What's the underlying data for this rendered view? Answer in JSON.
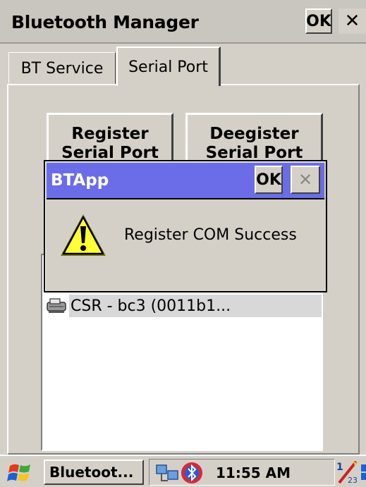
{
  "window": {
    "title": "Bluetooth Manager",
    "ok_label": "OK",
    "close_glyph": "✕"
  },
  "tabs": [
    {
      "label": "BT Service",
      "active": false
    },
    {
      "label": "Serial Port",
      "active": true
    }
  ],
  "buttons": {
    "register_line1": "Register",
    "register_line2": "Serial Port",
    "deregister_line1": "Deegister",
    "deregister_line2": "Serial Port"
  },
  "device_list": {
    "items": [
      {
        "label": "CSR - bc3 (0011b1...",
        "icon": "serial-port-device-icon",
        "selected": true
      }
    ]
  },
  "dialog": {
    "title": "BTApp",
    "ok_label": "OK",
    "close_glyph": "✕",
    "icon": "warning-icon",
    "message": "Register COM Success",
    "title_color": "#6b6de8"
  },
  "taskbar": {
    "start_icon": "windows-flag-icon",
    "task_label": "Bluetoot...",
    "tray_icons": [
      "network-icon",
      "bluetooth-icon"
    ],
    "clock": "11:55 AM",
    "input_icon": "input-panel-icon",
    "desktop_icon": "desktop-icon"
  },
  "colors": {
    "face": "#d4d0c8",
    "dialog_title": "#6b6de8",
    "selection": "#d8d8d8"
  }
}
